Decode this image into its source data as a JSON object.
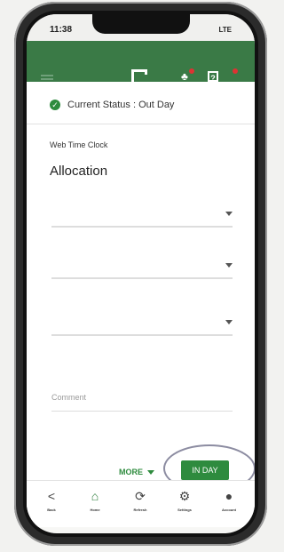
{
  "status_bar": {
    "time": "11:38",
    "signal": "LTE"
  },
  "app_bar": {
    "menu_icon": "hamburger-icon",
    "logo_icon": "app-logo-icon",
    "notifications_icon": "bell-icon",
    "help_icon": "help-icon",
    "help_glyph": "?",
    "colors": {
      "bar": "#3a7a46"
    }
  },
  "status": {
    "text": "Current Status : Out Day",
    "icon": "check-circle-icon"
  },
  "section": {
    "label": "Web Time Clock",
    "heading": "Allocation"
  },
  "fields": {
    "dropdown_1": {
      "placeholder": ""
    },
    "dropdown_2": {
      "placeholder": ""
    },
    "dropdown_3": {
      "placeholder": ""
    },
    "comment": {
      "placeholder": "Comment"
    }
  },
  "actions": {
    "more_label": "MORE",
    "in_day_label": "IN DAY",
    "colors": {
      "primary": "#2e8b3e"
    }
  },
  "bottom_nav": {
    "back": {
      "label": "Back",
      "icon": "chevron-left-icon"
    },
    "home": {
      "label": "Home",
      "icon": "home-icon"
    },
    "refresh": {
      "label": "Refresh",
      "icon": "refresh-icon"
    },
    "settings": {
      "label": "Settings",
      "icon": "gear-icon"
    },
    "account": {
      "label": "Account",
      "icon": "person-icon"
    }
  }
}
